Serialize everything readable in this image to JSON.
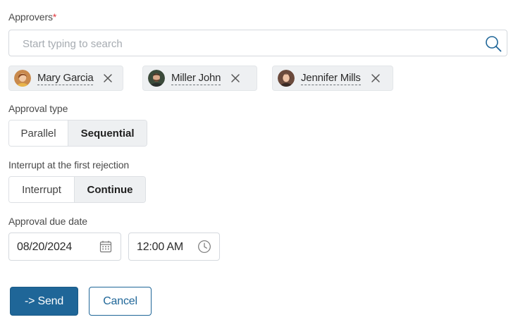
{
  "approvers": {
    "label": "Approvers",
    "required_mark": "*",
    "search": {
      "placeholder": "Start typing to search",
      "value": ""
    },
    "selected": [
      {
        "name": "Mary Garcia"
      },
      {
        "name": "Miller John"
      },
      {
        "name": "Jennifer Mills"
      }
    ]
  },
  "approval_type": {
    "label": "Approval type",
    "options": [
      "Parallel",
      "Sequential"
    ],
    "selected": "Sequential"
  },
  "interrupt": {
    "label": "Interrupt at the first rejection",
    "options": [
      "Interrupt",
      "Continue"
    ],
    "selected": "Continue"
  },
  "due_date": {
    "label": "Approval due date",
    "date": "08/20/2024",
    "time": "12:00 AM"
  },
  "actions": {
    "send_label": "-> Send",
    "cancel_label": "Cancel"
  },
  "colors": {
    "primary": "#1f6698",
    "required": "#e0353b",
    "chip_bg": "#eef0f2",
    "border": "#d5d9de"
  }
}
